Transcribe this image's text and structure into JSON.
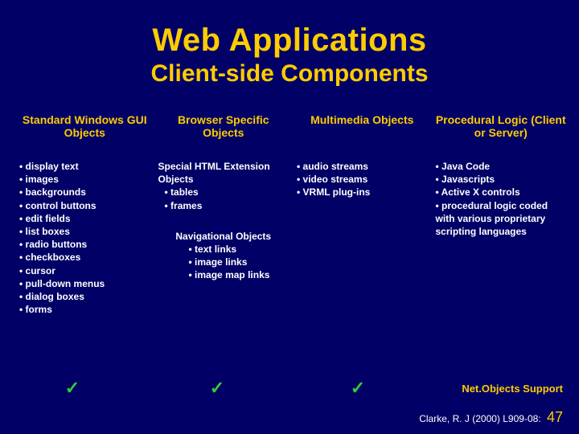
{
  "title": "Web Applications",
  "subtitle": "Client-side Components",
  "columns": {
    "col1": {
      "header": "Standard Windows GUI Objects",
      "items": [
        "display text",
        "images",
        "backgrounds",
        "control buttons",
        "edit fields",
        "list boxes",
        "radio buttons",
        "checkboxes",
        "cursor",
        "pull-down menus",
        "dialog boxes",
        "forms"
      ]
    },
    "col2": {
      "header": "Browser Specific Objects",
      "section1_title": "Special HTML Extension Objects",
      "section1_items": [
        "tables",
        "frames"
      ],
      "section2_title": "Navigational Objects",
      "section2_items": [
        "text links",
        "image links",
        "image map links"
      ]
    },
    "col3": {
      "header": "Multimedia Objects",
      "items": [
        "audio streams",
        "video streams",
        "VRML plug-ins"
      ]
    },
    "col4": {
      "header": "Procedural Logic (Client or Server)",
      "items": [
        "Java Code",
        "Javascripts",
        "Active X controls",
        "procedural logic coded with various proprietary scripting languages"
      ]
    }
  },
  "checks": {
    "c1": "✓",
    "c2": "✓",
    "c3": "✓"
  },
  "support_label": "Net.Objects Support",
  "citation_text": "Clarke, R. J (2000) L909-08:",
  "page_number": "47"
}
